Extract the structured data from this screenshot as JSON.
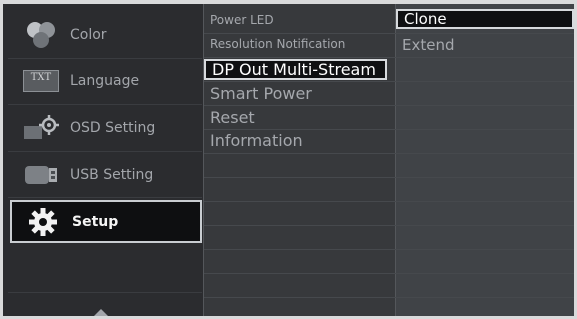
{
  "menu": {
    "items": [
      {
        "label": "Color",
        "icon": "color-icon"
      },
      {
        "label": "Language",
        "icon": "language-icon",
        "icon_text": "TXT"
      },
      {
        "label": "OSD Setting",
        "icon": "osd-setting-icon"
      },
      {
        "label": "USB Setting",
        "icon": "usb-setting-icon"
      },
      {
        "label": "Setup",
        "icon": "gear-icon",
        "active": true
      }
    ]
  },
  "submenu": {
    "items": [
      {
        "label": "Power LED"
      },
      {
        "label": "Resolution Notification"
      },
      {
        "label": "DP Out Multi-Stream",
        "selected": true
      },
      {
        "label": "Smart Power"
      },
      {
        "label": "Reset"
      },
      {
        "label": "Information"
      }
    ]
  },
  "options": {
    "items": [
      {
        "label": "Clone",
        "selected": true
      },
      {
        "label": "Extend"
      }
    ]
  },
  "colors": {
    "panel": "#2b2c2f",
    "mid": "#37393c",
    "right": "#404347",
    "highlight_border": "#d7dadd",
    "text": "#a5a8ad"
  }
}
